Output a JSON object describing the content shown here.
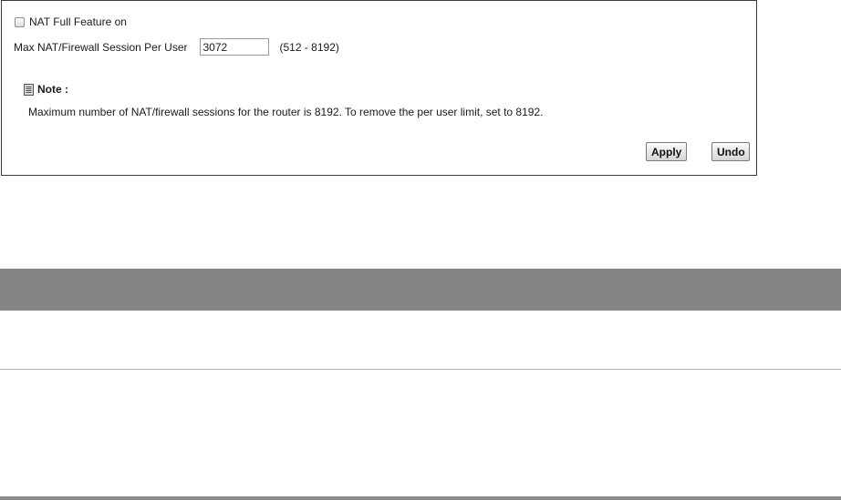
{
  "nat_panel": {
    "full_feature_label": "NAT Full Feature on",
    "full_feature_checked": false,
    "session_label": "Max NAT/Firewall Session Per User",
    "session_value": "3072",
    "session_range": "(512 - 8192)",
    "note_icon": "document-icon",
    "note_title": "Note :",
    "note_text": "Maximum number of NAT/firewall sessions for the router is 8192. To remove the per user limit, set to 8192.",
    "apply_label": "Apply",
    "undo_label": "Undo"
  },
  "colors": {
    "section_header_bg": "#858585",
    "panel_border": "#3a3a3a"
  }
}
